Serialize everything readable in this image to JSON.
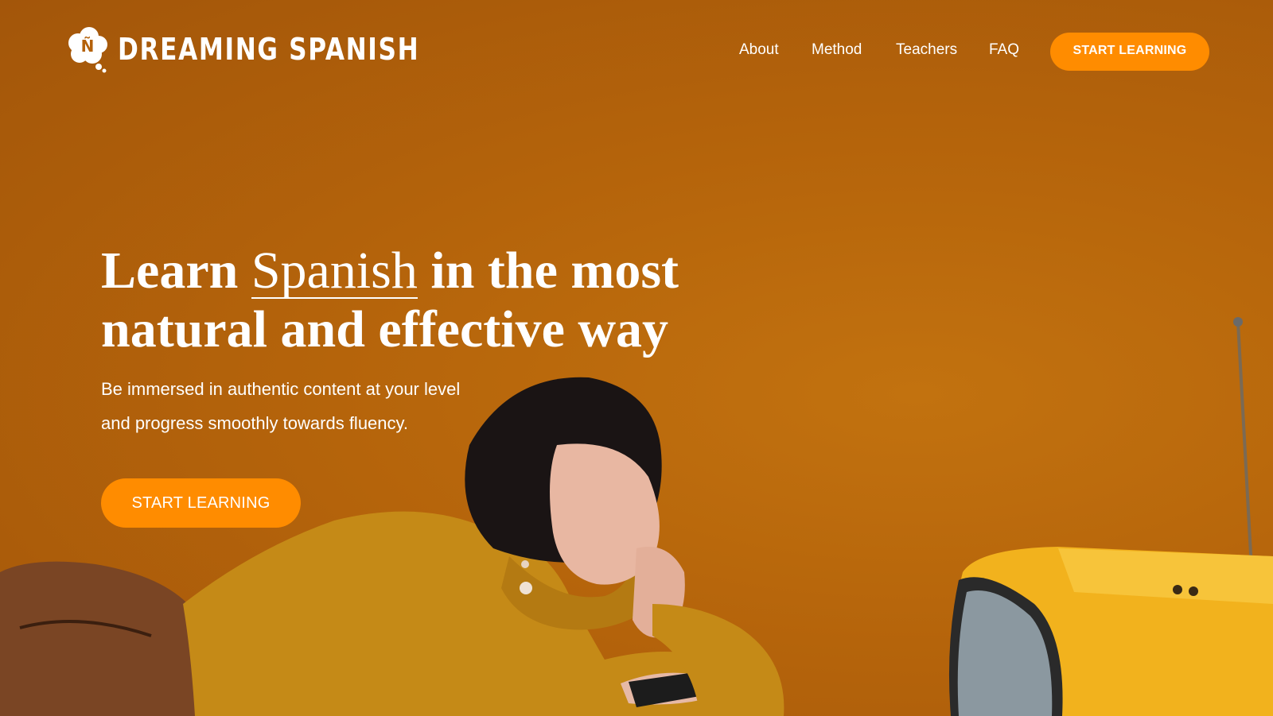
{
  "brand": {
    "name": "DREAMING SPANISH",
    "logo_glyph": "Ñ",
    "logo_icon": "cloud-logo-icon"
  },
  "nav": {
    "items": [
      {
        "label": "About"
      },
      {
        "label": "Method"
      },
      {
        "label": "Teachers"
      },
      {
        "label": "FAQ"
      }
    ],
    "cta_label": "START LEARNING"
  },
  "hero": {
    "headline_part1": "Learn ",
    "headline_highlight": "Spanish",
    "headline_part2": " in the most natural and effective way",
    "subtext_line1": "Be immersed in authentic content at your level",
    "subtext_line2": "and progress smoothly towards fluency.",
    "cta_label": "START LEARNING"
  },
  "colors": {
    "background": "#b4610a",
    "accent": "#ff8c00",
    "text": "#ffffff"
  }
}
